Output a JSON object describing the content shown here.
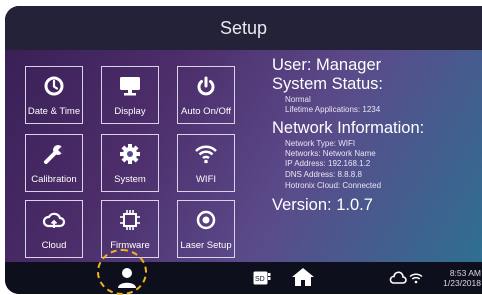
{
  "header": {
    "title": "Setup"
  },
  "tiles": [
    {
      "label": "Date & Time",
      "icon": "clock-icon"
    },
    {
      "label": "Display",
      "icon": "monitor-icon"
    },
    {
      "label": "Auto On/Off",
      "icon": "power-icon"
    },
    {
      "label": "Calibration",
      "icon": "wrench-icon"
    },
    {
      "label": "System",
      "icon": "gear-icon"
    },
    {
      "label": "WIFI",
      "icon": "wifi-icon"
    },
    {
      "label": "Cloud",
      "icon": "cloud-icon"
    },
    {
      "label": "Firmware",
      "icon": "chip-icon"
    },
    {
      "label": "Laser Setup",
      "icon": "target-icon"
    }
  ],
  "info": {
    "user": "User: Manager",
    "system_status_title": "System Status:",
    "status": "Normal",
    "lifetime": "Lifetime Applications: 1234",
    "network_title": "Network Information:",
    "network_type": "Network Type: WIFI",
    "networks": "Networks: Network Name",
    "ip": "IP Address: 192.168.1.2",
    "dns": "DNS Address: 8.8.8.8",
    "cloud": "Hotronix Cloud: Connected",
    "version": "Version: 1.0.7"
  },
  "bottom_bar": {
    "time": "8:53 AM",
    "date": "1/23/2018",
    "icons": [
      "user-icon",
      "sd-card-icon",
      "home-icon",
      "cloud-icon",
      "wifi-icon"
    ]
  },
  "colors": {
    "accent_dashed_ring": "#f1b21c",
    "title_bar": "#232238",
    "bottom_bar": "#0e0f1c"
  }
}
